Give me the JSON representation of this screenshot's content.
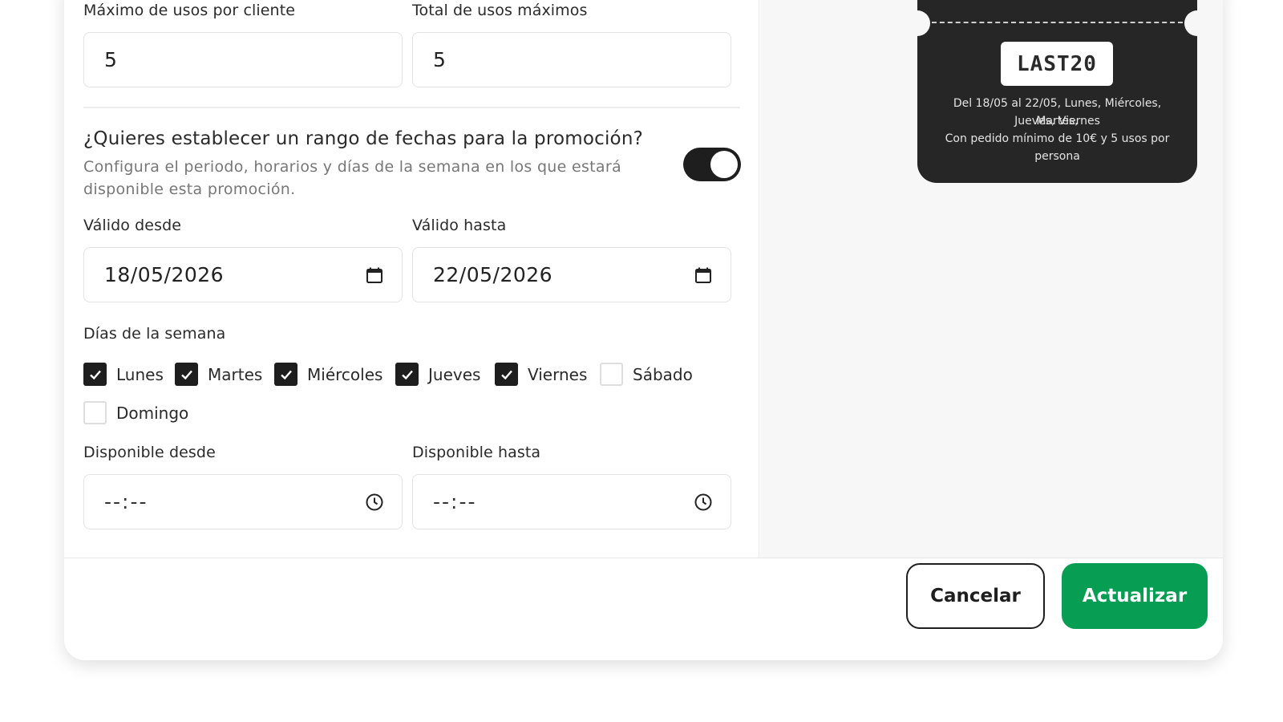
{
  "usage": {
    "max_per_client_label": "Máximo de usos por cliente",
    "max_per_client_value": "5",
    "total_max_label": "Total de usos máximos",
    "total_max_value": "5"
  },
  "date_range": {
    "question": "¿Quieres establecer un rango de fechas para la promoción?",
    "description": "Configura el periodo, horarios y días de la semana en los que estará disponible esta promoción.",
    "toggle_on": true,
    "valid_from_label": "Válido desde",
    "valid_from_value": "18/05/2026",
    "valid_to_label": "Válido hasta",
    "valid_to_value": "22/05/2026"
  },
  "weekdays": {
    "label": "Días de la semana",
    "days": [
      {
        "name": "Lunes",
        "checked": true
      },
      {
        "name": "Martes",
        "checked": true
      },
      {
        "name": "Miércoles",
        "checked": true
      },
      {
        "name": "Jueves",
        "checked": true
      },
      {
        "name": "Viernes",
        "checked": true
      },
      {
        "name": "Sábado",
        "checked": false
      },
      {
        "name": "Domingo",
        "checked": false
      }
    ]
  },
  "hours": {
    "from_label": "Disponible desde",
    "from_value": "--:--",
    "to_label": "Disponible hasta",
    "to_value": "--:--"
  },
  "preview": {
    "code": "LAST20",
    "line1": "Del 18/05 al 22/05, Lunes, Miércoles, Martes,",
    "line2": "Jueves, Viernes",
    "line3": "Con pedido mínimo de 10€ y 5 usos por",
    "line4": "persona"
  },
  "footer": {
    "cancel_label": "Cancelar",
    "update_label": "Actualizar"
  },
  "colors": {
    "accent": "#079d52",
    "dark": "#1e1e1e",
    "ticket": "#262626"
  },
  "icons": {
    "date": "calendar-icon",
    "time": "clock-icon",
    "check": "check-icon"
  }
}
